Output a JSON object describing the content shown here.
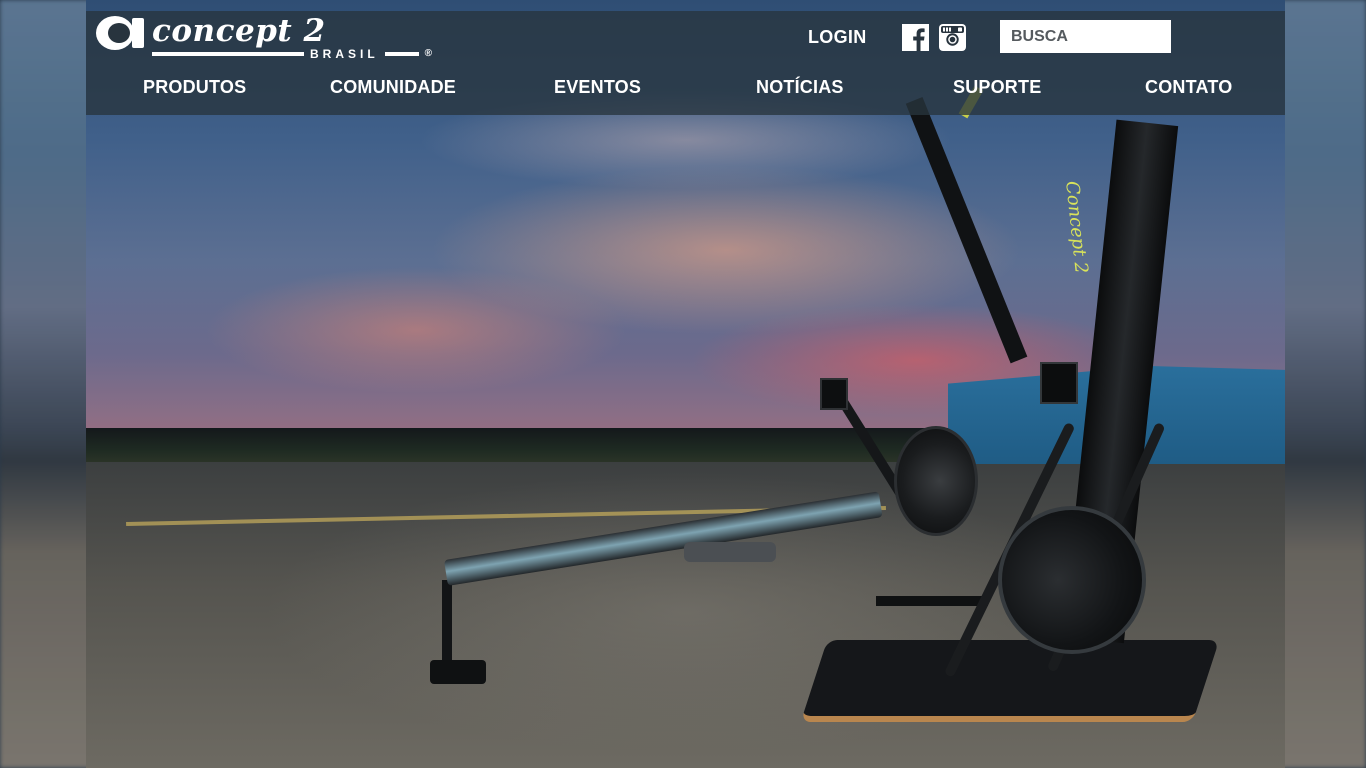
{
  "brand": {
    "logo_word": "concept 2",
    "logo_sub": "BRASIL",
    "registered_mark": "®"
  },
  "header": {
    "login_label": "LOGIN",
    "search_placeholder": "BUSCA",
    "social": [
      {
        "icon": "facebook-icon"
      },
      {
        "icon": "instagram-icon"
      }
    ]
  },
  "nav": {
    "items": [
      {
        "label": "PRODUTOS"
      },
      {
        "label": "COMUNIDADE"
      },
      {
        "label": "EVENTOS"
      },
      {
        "label": "NOTÍCIAS"
      },
      {
        "label": "SUPORTE"
      },
      {
        "label": "CONTATO"
      }
    ]
  },
  "hero": {
    "product_brand_text": "Concept 2"
  },
  "colors": {
    "header_bg": "#28343e",
    "text": "#ffffff",
    "accent_yellow": "#d9e35a"
  }
}
